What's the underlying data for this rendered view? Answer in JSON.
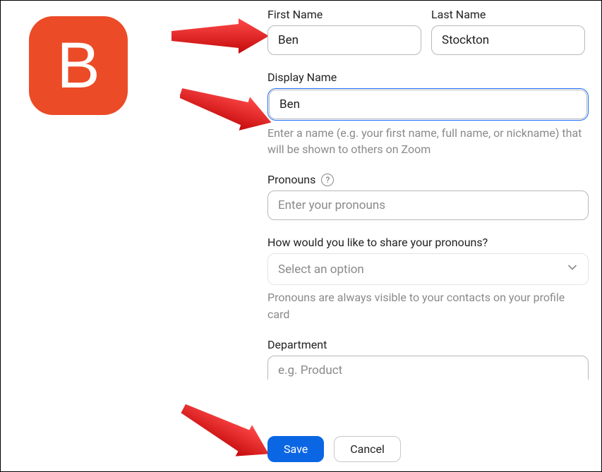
{
  "avatar_letter": "B",
  "first_name": {
    "label": "First Name",
    "value": "Ben"
  },
  "last_name": {
    "label": "Last Name",
    "value": "Stockton"
  },
  "display_name": {
    "label": "Display Name",
    "value": "Ben",
    "hint": "Enter a name (e.g. your first name, full name, or nickname) that will be shown to others on Zoom"
  },
  "pronouns": {
    "label": "Pronouns",
    "placeholder": "Enter your pronouns",
    "value": ""
  },
  "pronouns_share": {
    "label": "How would you like to share your pronouns?",
    "placeholder": "Select an option",
    "hint": "Pronouns are always visible to your contacts on your profile card"
  },
  "department": {
    "label": "Department",
    "placeholder": "e.g. Product"
  },
  "buttons": {
    "save": "Save",
    "cancel": "Cancel"
  }
}
